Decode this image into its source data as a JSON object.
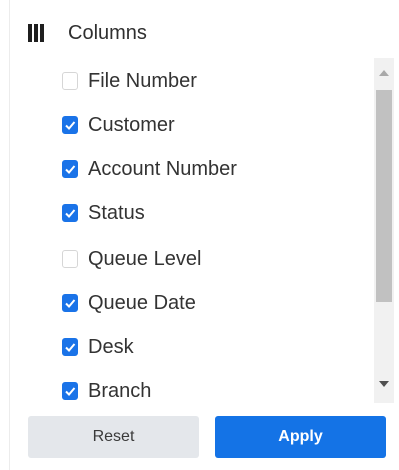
{
  "header": {
    "title": "Columns",
    "icon": "columns-icon"
  },
  "columns": [
    {
      "label": "File Number",
      "checked": false
    },
    {
      "label": "Customer",
      "checked": true
    },
    {
      "label": "Account Number",
      "checked": true
    },
    {
      "label": "Status",
      "checked": true
    },
    {
      "label": "Queue Level",
      "checked": false
    },
    {
      "label": "Queue Date",
      "checked": true
    },
    {
      "label": "Desk",
      "checked": true
    },
    {
      "label": "Branch",
      "checked": true
    }
  ],
  "buttons": {
    "reset": "Reset",
    "apply": "Apply"
  },
  "colors": {
    "checkbox_checked": "#1a73e8",
    "apply_button": "#1473e6",
    "reset_button": "#e4e7eb",
    "scroll_thumb": "#c1c1c1"
  }
}
